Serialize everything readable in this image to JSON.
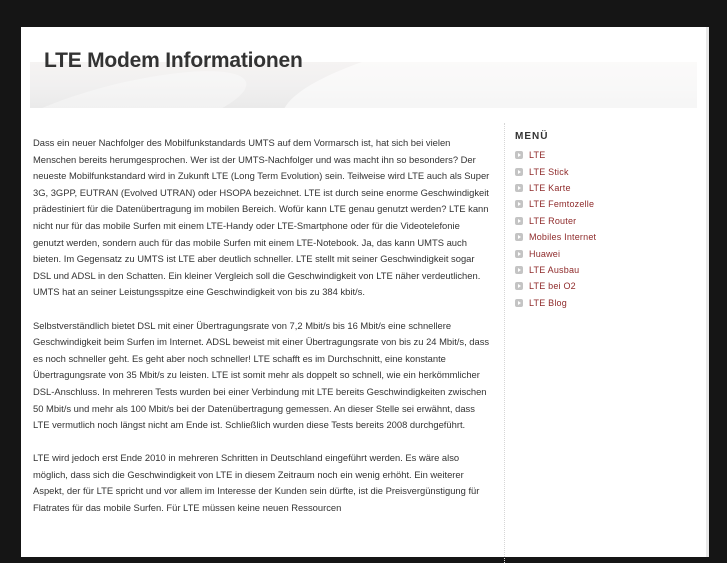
{
  "header": {
    "title": "LTE Modem Informationen"
  },
  "content": {
    "paragraphs": [
      "Dass ein neuer Nachfolger des Mobilfunkstandards UMTS auf dem Vormarsch ist, hat sich bei vielen Menschen bereits herumgesprochen. Wer ist der UMTS-Nachfolger und was macht ihn so besonders? Der neueste Mobilfunkstandard wird in Zukunft LTE (Long Term Evolution) sein. Teilweise wird LTE auch als Super 3G, 3GPP, EUTRAN (Evolved UTRAN) oder HSOPA bezeichnet. LTE ist durch seine enorme Geschwindigkeit prädestiniert für die Datenübertragung im mobilen Bereich. Wofür kann LTE genau genutzt werden? LTE kann nicht nur für das mobile Surfen mit einem LTE-Handy oder LTE-Smartphone oder für die Videotelefonie genutzt werden, sondern auch für das mobile Surfen mit einem LTE-Notebook. Ja, das kann UMTS auch bieten. Im Gegensatz zu UMTS ist LTE aber deutlich schneller. LTE stellt mit seiner Geschwindigkeit sogar DSL und ADSL in den Schatten. Ein kleiner Vergleich soll die Geschwindigkeit von LTE näher verdeutlichen. UMTS hat an seiner Leistungsspitze eine Geschwindigkeit von bis zu 384 kbit/s.",
      "Selbstverständlich bietet DSL mit einer Übertragungsrate von 7,2 Mbit/s bis 16 Mbit/s eine schnellere Geschwindigkeit beim Surfen im Internet. ADSL beweist mit einer Übertragungsrate von bis zu 24 Mbit/s, dass es noch schneller geht. Es geht aber noch schneller! LTE schafft es im Durchschnitt, eine konstante Übertragungsrate von 35 Mbit/s zu leisten. LTE ist somit mehr als doppelt so schnell, wie ein herkömmlicher DSL-Anschluss. In mehreren Tests wurden bei einer Verbindung mit LTE bereits Geschwindigkeiten zwischen 50 Mbit/s und mehr als 100 Mbit/s bei der Datenübertragung gemessen. An dieser Stelle sei erwähnt, dass LTE vermutlich noch längst nicht am Ende ist. Schließlich wurden diese Tests bereits 2008 durchgeführt.",
      "LTE wird jedoch erst Ende 2010 in mehreren Schritten in Deutschland eingeführt werden. Es wäre also möglich, dass sich die Geschwindigkeit von LTE in diesem Zeitraum noch ein wenig erhöht. Ein weiterer Aspekt, der für LTE spricht und vor allem im Interesse der Kunden sein dürfte, ist die Preisvergünstigung für Flatrates für das mobile Surfen. Für LTE müssen keine neuen Ressourcen"
    ]
  },
  "sidebar": {
    "title": "MENÜ",
    "bullet_icon": "arrow-bullet-icon",
    "items": [
      {
        "label": "LTE"
      },
      {
        "label": "LTE Stick"
      },
      {
        "label": "LTE Karte"
      },
      {
        "label": "LTE Femtozelle"
      },
      {
        "label": "LTE Router"
      },
      {
        "label": "Mobiles Internet"
      },
      {
        "label": "Huawei"
      },
      {
        "label": "LTE Ausbau"
      },
      {
        "label": "LTE bei O2"
      },
      {
        "label": "LTE Blog"
      }
    ]
  },
  "colors": {
    "background": "#151515",
    "page": "#ffffff",
    "text": "#333333",
    "link": "#8f2b2b",
    "bullet": "#c4c4c4"
  }
}
